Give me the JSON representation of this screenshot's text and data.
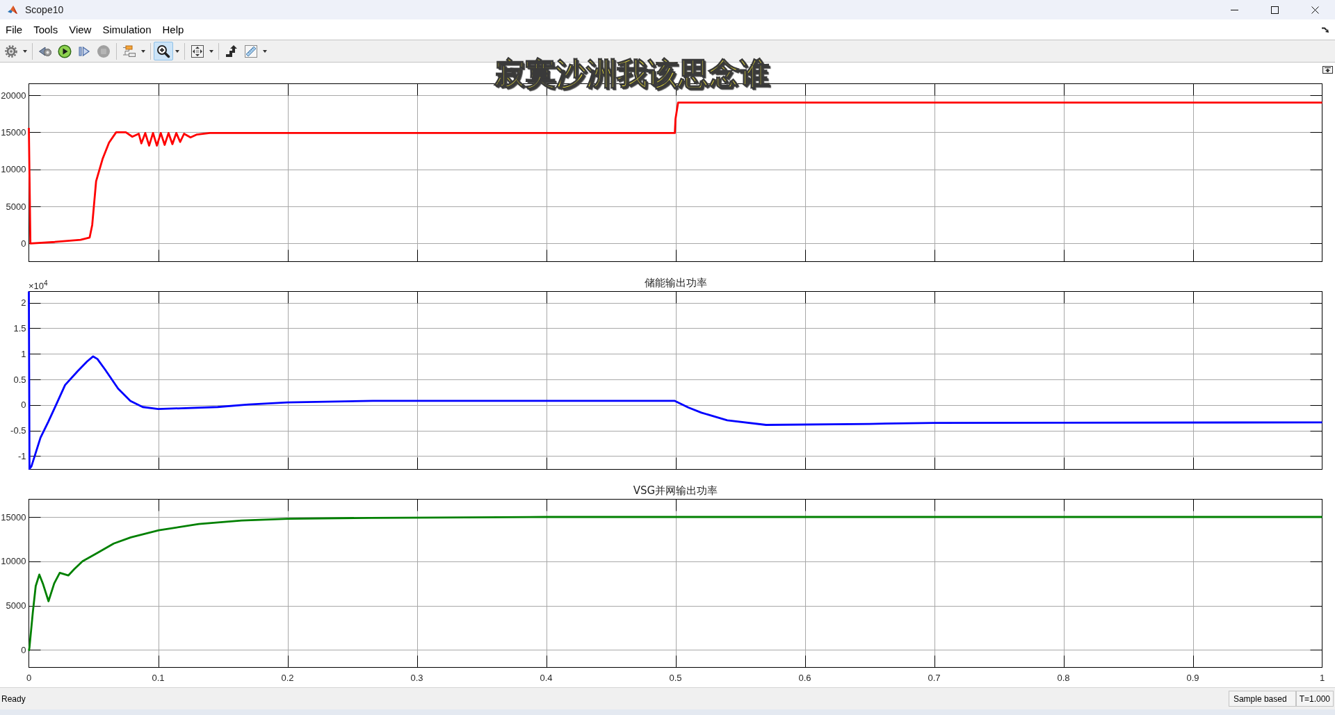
{
  "window": {
    "title": "Scope10"
  },
  "menu_bar": [
    "File",
    "Tools",
    "View",
    "Simulation",
    "Help"
  ],
  "toolbar": {
    "groups": [
      [
        {
          "dropdown": true,
          "selected": false,
          "disabled": false
        }
      ],
      [
        {
          "dropdown": false,
          "selected": false,
          "disabled": false
        },
        {
          "dropdown": false,
          "selected": false,
          "disabled": false
        },
        {
          "dropdown": false,
          "selected": false,
          "disabled": false
        },
        {
          "dropdown": false,
          "selected": false,
          "disabled": true
        }
      ],
      [
        {
          "dropdown": true,
          "selected": false,
          "disabled": false
        }
      ],
      [
        {
          "dropdown": true,
          "selected": true,
          "disabled": false
        }
      ],
      [
        {
          "dropdown": true,
          "selected": false,
          "disabled": false
        }
      ],
      [
        {
          "dropdown": false,
          "selected": false,
          "disabled": false
        },
        {
          "dropdown": true,
          "selected": false,
          "disabled": false
        }
      ]
    ]
  },
  "overlay_caption": "寂寞沙洲我该思念谁",
  "plots": [
    {
      "chart_data": {
        "type": "line",
        "x": [
          0,
          0.0012,
          0.02,
          0.04,
          0.047,
          0.049,
          0.052,
          0.057,
          0.062,
          0.0675,
          0.075,
          0.08,
          0.085,
          0.087,
          0.09,
          0.093,
          0.096,
          0.099,
          0.102,
          0.105,
          0.108,
          0.111,
          0.114,
          0.117,
          0.12,
          0.125,
          0.13,
          0.14,
          0.3,
          0.4995,
          0.5,
          0.502,
          0.6,
          1
        ],
        "series": [
          {
            "color": "#ff0000",
            "values": [
              15600,
              0,
              200,
              500,
              800,
              2500,
              8400,
              11400,
              13600,
              15000,
              15000,
              14400,
              14800,
              13500,
              14900,
              13200,
              14900,
              13200,
              14900,
              13300,
              14900,
              13400,
              14900,
              13700,
              14800,
              14300,
              14700,
              14900,
              14900,
              14900,
              16800,
              19000,
              19000,
              19000
            ]
          }
        ],
        "xlim": [
          0,
          1
        ],
        "ylim": [
          -2450,
          21550
        ],
        "yticks": [
          0,
          5000,
          10000,
          15000,
          20000
        ],
        "grid": true
      }
    },
    {
      "y_multiplier": "×10$^{4}$",
      "chart_data": {
        "type": "line",
        "title": "储能输出功率",
        "x": [
          0,
          0.0005,
          0.002,
          0.009,
          0.015,
          0.021,
          0.028,
          0.0377,
          0.045,
          0.0497,
          0.053,
          0.059,
          0.069,
          0.0785,
          0.088,
          0.1,
          0.146,
          0.17,
          0.2,
          0.266,
          0.35,
          0.4995,
          0.51,
          0.52,
          0.54,
          0.57,
          0.65,
          0.7,
          1
        ],
        "series": [
          {
            "color": "#0000ff",
            "values": [
              2.22,
              -1.25,
              -1.2,
              -0.64,
              -0.33,
              0,
              0.39,
              0.66,
              0.85,
              0.95,
              0.9,
              0.69,
              0.32,
              0.08,
              -0.04,
              -0.08,
              -0.04,
              0.01,
              0.05,
              0.08,
              0.08,
              0.08,
              -0.05,
              -0.15,
              -0.3,
              -0.39,
              -0.37,
              -0.35,
              -0.34
            ]
          }
        ],
        "xlim": [
          0,
          1
        ],
        "ylim": [
          -1.26,
          2.22
        ],
        "yticks": [
          -1,
          -0.5,
          0,
          0.5,
          1,
          1.5,
          2
        ],
        "grid": true
      }
    },
    {
      "chart_data": {
        "type": "line",
        "title": "VSG并网输出功率",
        "x": [
          0,
          0.0004,
          0.0031,
          0.0053,
          0.0081,
          0.0108,
          0.0152,
          0.0196,
          0.0239,
          0.0305,
          0.035,
          0.0415,
          0.0525,
          0.0656,
          0.0788,
          0.1005,
          0.1314,
          0.1644,
          0.2,
          0.263,
          0.4,
          1
        ],
        "series": [
          {
            "color": "#008000",
            "values": [
              -100,
              200,
              4300,
              7200,
              8500,
              7500,
              5500,
              7500,
              8700,
              8400,
              9100,
              10000,
              10900,
              12000,
              12700,
              13500,
              14200,
              14600,
              14800,
              14900,
              15000,
              15000
            ]
          }
        ],
        "xlim": [
          0,
          1
        ],
        "ylim": [
          -1970,
          17000
        ],
        "xticks": [
          0,
          0.1,
          0.2,
          0.3,
          0.4,
          0.5,
          0.6,
          0.7,
          0.8,
          0.9,
          1
        ],
        "yticks": [
          0,
          5000,
          10000,
          15000
        ],
        "grid": true
      }
    }
  ],
  "status_bar": {
    "message": "Ready",
    "fields": [
      "Sample based",
      "T=1.000"
    ]
  }
}
